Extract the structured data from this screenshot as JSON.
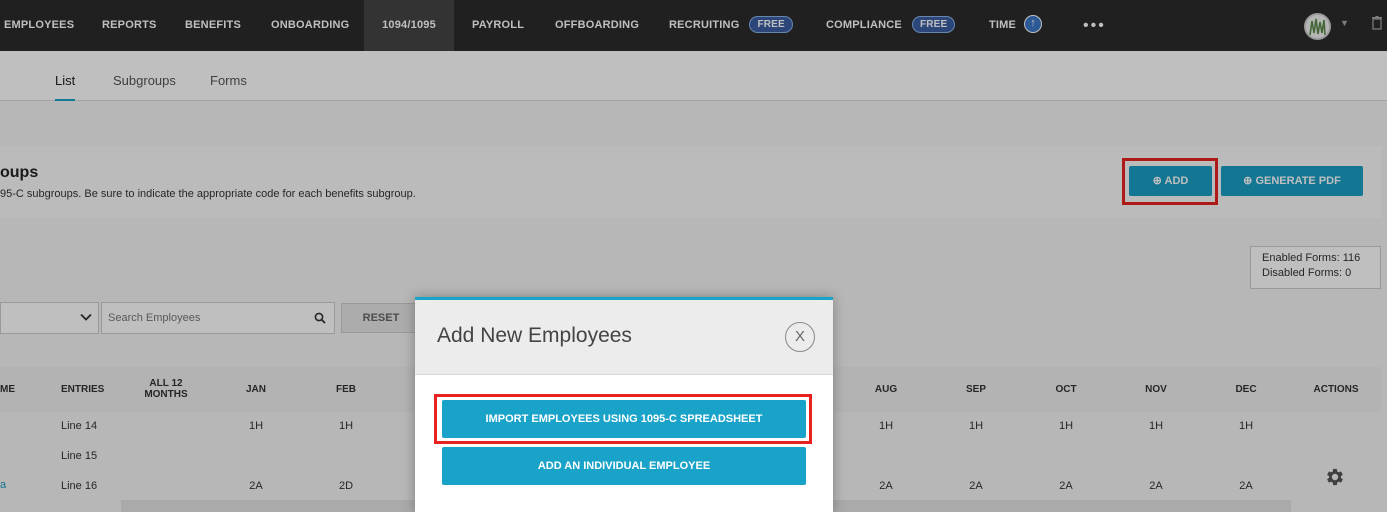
{
  "topnav": {
    "items": [
      {
        "label": "EMPLOYEES"
      },
      {
        "label": "REPORTS"
      },
      {
        "label": "BENEFITS"
      },
      {
        "label": "ONBOARDING"
      },
      {
        "label": "1094/1095"
      },
      {
        "label": "PAYROLL"
      },
      {
        "label": "OFFBOARDING"
      },
      {
        "label": "RECRUITING",
        "badge": "FREE"
      },
      {
        "label": "COMPLIANCE",
        "badge": "FREE"
      },
      {
        "label": "TIME"
      }
    ],
    "more": "•••",
    "active": "1094/1095"
  },
  "subnav": {
    "tabs": [
      {
        "label": "List"
      },
      {
        "label": "Subgroups"
      },
      {
        "label": "Forms"
      }
    ],
    "active": "List"
  },
  "header": {
    "title": "oups",
    "description": "95-C subgroups. Be sure to indicate the appropriate code for each benefits subgroup.",
    "add_label": "ADD",
    "generate_label": "GENERATE PDF"
  },
  "forms_info": {
    "enabled": "Enabled Forms: 116",
    "disabled": "Disabled Forms: 0"
  },
  "filters": {
    "search_placeholder": "Search Employees",
    "reset_label": "RESET"
  },
  "table": {
    "headers": {
      "name": "ME",
      "entries": "ENTRIES",
      "all12_line1": "ALL 12",
      "all12_line2": "MONTHS",
      "jan": "JAN",
      "feb": "FEB",
      "aug": "AUG",
      "sep": "SEP",
      "oct": "OCT",
      "nov": "NOV",
      "dec": "DEC",
      "actions": "ACTIONS"
    },
    "rows": [
      {
        "entry": "Line 14",
        "jan": "1H",
        "feb": "1H",
        "aug": "1H",
        "sep": "1H",
        "oct": "1H",
        "nov": "1H",
        "dec": "1H"
      },
      {
        "entry": "Line 15",
        "jan": "",
        "feb": "",
        "aug": "",
        "sep": "",
        "oct": "",
        "nov": "",
        "dec": ""
      },
      {
        "entry": "Line 16",
        "jan": "2A",
        "feb": "2D",
        "aug": "2A",
        "sep": "2A",
        "oct": "2A",
        "nov": "2A",
        "dec": "2A"
      }
    ],
    "name_link": "a"
  },
  "modal": {
    "title": "Add New Employees",
    "close": "X",
    "import_label": "IMPORT EMPLOYEES USING 1095-C SPREADSHEET",
    "add_individual_label": "ADD AN INDIVIDUAL EMPLOYEE"
  },
  "colors": {
    "nav_bg": "#2b2b2b",
    "accent": "#1aa3c9",
    "highlight": "#e8231f",
    "badge": "#3b5ea3"
  }
}
